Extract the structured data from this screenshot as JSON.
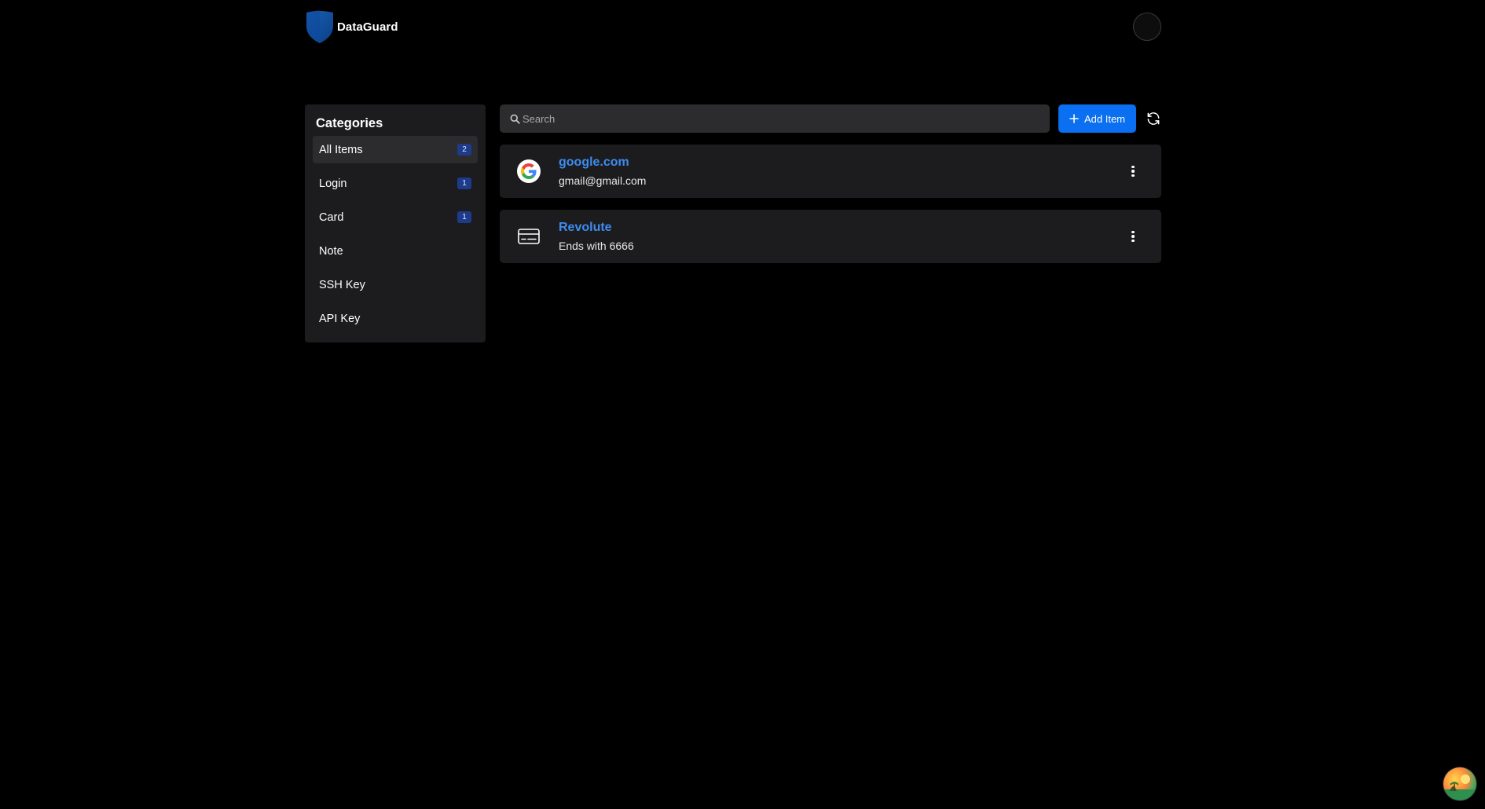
{
  "app": {
    "name": "DataGuard"
  },
  "sidebar": {
    "title": "Categories",
    "items": [
      {
        "label": "All Items",
        "count": "2",
        "active": true
      },
      {
        "label": "Login",
        "count": "1"
      },
      {
        "label": "Card",
        "count": "1"
      },
      {
        "label": "Note",
        "count": ""
      },
      {
        "label": "SSH Key",
        "count": ""
      },
      {
        "label": "API Key",
        "count": ""
      }
    ]
  },
  "toolbar": {
    "search_placeholder": "Search",
    "search_value": "",
    "add_label": "Add Item"
  },
  "items": [
    {
      "title": "google.com",
      "subtitle": "gmail@gmail.com",
      "icon": "google-icon"
    },
    {
      "title": "Revolute",
      "subtitle": "Ends with 6666",
      "icon": "credit-card-icon"
    }
  ],
  "colors": {
    "accent": "#0a6ff0",
    "link": "#3d8cf0",
    "badge": "#1e3a8a",
    "panel": "#1c1c1e",
    "background": "#000000"
  }
}
